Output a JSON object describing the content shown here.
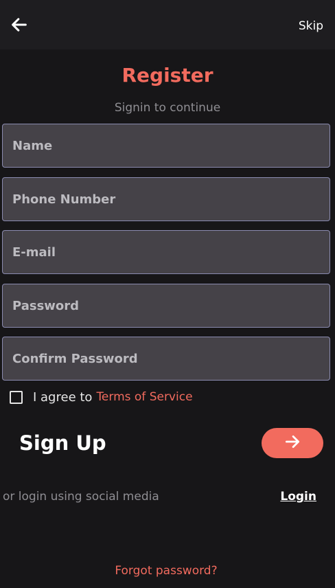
{
  "header": {
    "back_icon": "arrow-left-icon",
    "skip_label": "Skip"
  },
  "title": "Register",
  "subtitle": "Signin to continue",
  "fields": {
    "name": {
      "placeholder": "Name",
      "value": ""
    },
    "phone": {
      "placeholder": "Phone Number",
      "value": ""
    },
    "email": {
      "placeholder": "E-mail",
      "value": ""
    },
    "password": {
      "placeholder": "Password",
      "value": ""
    },
    "confirm_password": {
      "placeholder": "Confirm Password",
      "value": ""
    }
  },
  "agree": {
    "checked": false,
    "text": "I agree to",
    "terms_link": "Terms of Service"
  },
  "signup": {
    "label": "Sign Up",
    "button_icon": "arrow-right-icon"
  },
  "social": {
    "text": "or login using social media",
    "login_link": "Login"
  },
  "forgot_password": "Forgot password?",
  "colors": {
    "accent": "#f26b5e",
    "background": "#171618",
    "topbar": "#1e1d20",
    "field_bg": "#454248",
    "field_border": "#8b8bb0"
  }
}
